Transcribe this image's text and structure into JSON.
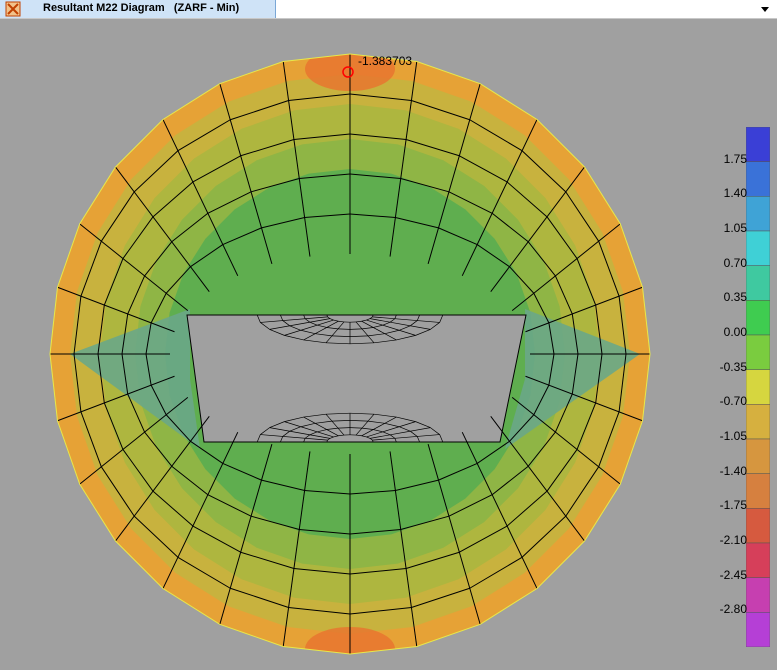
{
  "window": {
    "title": "Resultant M22 Diagram   (ZARF - Min)",
    "app_icon": "sap-app-icon",
    "dropdown_icon": "chevron-down-icon"
  },
  "diagram": {
    "peak_value_label": "-1.383703",
    "peak_marker_color": "#ff0000",
    "background_color": "#a0a0a0",
    "mesh_line_color": "#000000"
  },
  "legend": {
    "labels": [
      "1.75",
      "1.40",
      "1.05",
      "0.70",
      "0.35",
      "0.00",
      "-0.35",
      "-0.70",
      "-1.05",
      "-1.40",
      "-1.75",
      "-2.10",
      "-2.45",
      "-2.80"
    ],
    "colors": [
      "#3a3fd6",
      "#3a72d8",
      "#3fa3d6",
      "#3fd0d6",
      "#3fc9a0",
      "#3fcc50",
      "#7acc3f",
      "#d6d63f",
      "#d6b03f",
      "#d6963f",
      "#d6803f",
      "#d65a3f",
      "#d63f5a",
      "#c63fb0",
      "#b53fd6"
    ]
  }
}
